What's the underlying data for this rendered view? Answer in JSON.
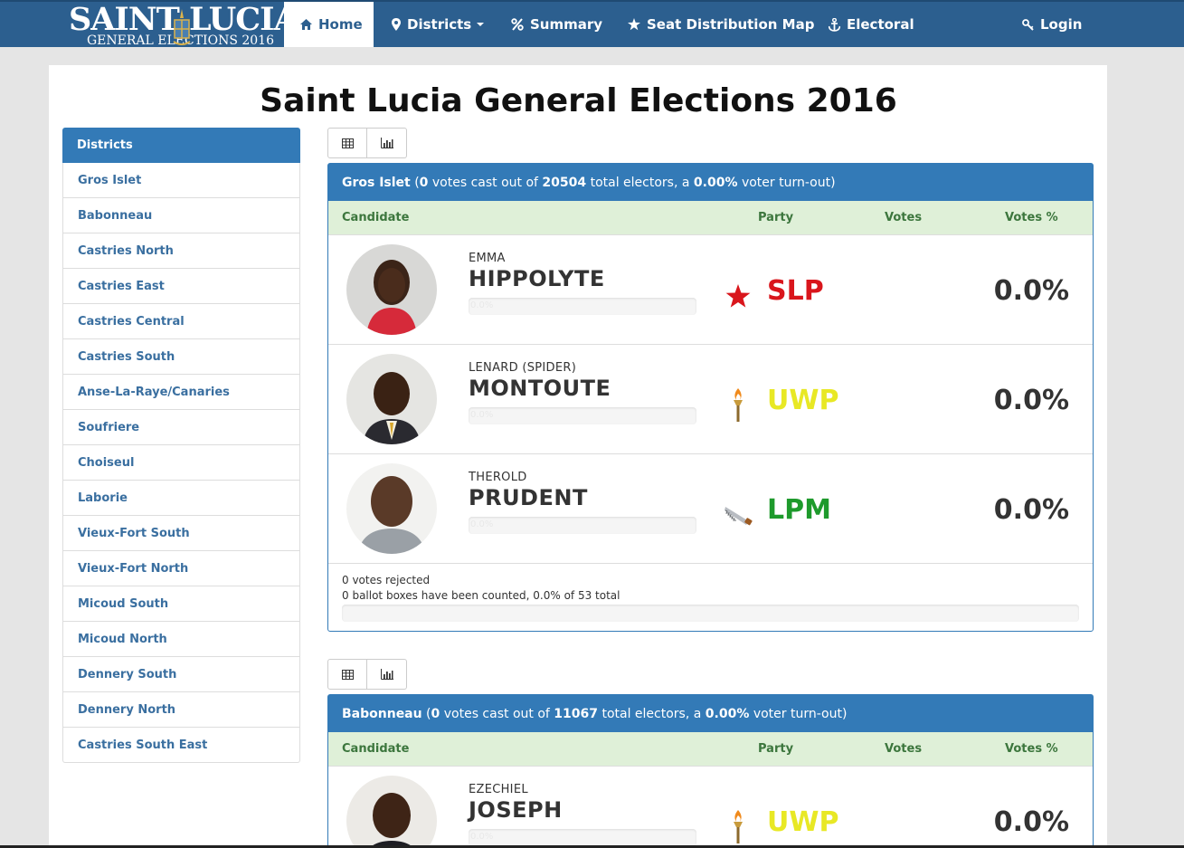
{
  "nav": {
    "brand_line1": "SAINT LUCIA",
    "brand_line2": "GENERAL ELECTIONS 2016",
    "items": [
      {
        "label": "Home",
        "icon": "home-icon",
        "active": true
      },
      {
        "label": "Districts",
        "icon": "map-marker-icon",
        "dropdown": true
      },
      {
        "label": "Summary",
        "icon": "percent-icon"
      },
      {
        "label": "Seat Distribution Map",
        "icon": "star-icon"
      },
      {
        "label": "Electoral",
        "icon": "anchor-icon"
      }
    ],
    "login": {
      "label": "Login",
      "icon": "key-icon"
    }
  },
  "page": {
    "title": "Saint Lucia General Elections 2016"
  },
  "sidebar": {
    "header": "Districts",
    "items": [
      "Gros Islet",
      "Babonneau",
      "Castries North",
      "Castries East",
      "Castries Central",
      "Castries South",
      "Anse-La-Raye/Canaries",
      "Soufriere",
      "Choiseul",
      "Laborie",
      "Vieux-Fort South",
      "Vieux-Fort North",
      "Micoud South",
      "Micoud North",
      "Dennery South",
      "Dennery North",
      "Castries South East"
    ]
  },
  "columns": {
    "candidate": "Candidate",
    "party": "Party",
    "votes": "Votes",
    "votes_pct": "Votes %"
  },
  "colors": {
    "navbar": "#2c5f8f",
    "primary": "#337ab7",
    "slp": "#d9161c",
    "uwp": "#e8e825",
    "lpm": "#1e9a2c"
  },
  "districts": [
    {
      "name": "Gros Islet",
      "votes_cast": "0",
      "text_votes_cast": "votes cast out of",
      "total_electors": "20504",
      "text_total_electors": "total electors, a",
      "turnout": "0.00%",
      "text_turnout": "voter turn-out)",
      "candidates": [
        {
          "first": "EMMA",
          "last": "HIPPOLYTE",
          "bar_label": "0.0%",
          "party": "SLP",
          "emblem": "star-icon",
          "votes": "",
          "pct": "0.0%",
          "party_color": "#d9161c",
          "photo": "emma-hippolyte"
        },
        {
          "first": "LENARD (SPIDER)",
          "last": "MONTOUTE",
          "bar_label": "0.0%",
          "party": "UWP",
          "emblem": "torch-icon",
          "votes": "",
          "pct": "0.0%",
          "party_color": "#e8e825",
          "photo": "lenard-montoute"
        },
        {
          "first": "THEROLD",
          "last": "PRUDENT",
          "bar_label": "0.0%",
          "party": "LPM",
          "emblem": "saw-icon",
          "votes": "",
          "pct": "0.0%",
          "party_color": "#1e9a2c",
          "photo": "therold-prudent"
        }
      ],
      "footer": {
        "rejected": "0 votes rejected",
        "boxes": "0 ballot boxes have been counted, 0.0% of 53 total"
      }
    },
    {
      "name": "Babonneau",
      "votes_cast": "0",
      "text_votes_cast": "votes cast out of",
      "total_electors": "11067",
      "text_total_electors": "total electors, a",
      "turnout": "0.00%",
      "text_turnout": "voter turn-out)",
      "candidates": [
        {
          "first": "EZECHIEL",
          "last": "JOSEPH",
          "bar_label": "0.0%",
          "party": "UWP",
          "emblem": "torch-icon",
          "votes": "",
          "pct": "0.0%",
          "party_color": "#e8e825",
          "photo": "ezechiel-joseph"
        }
      ]
    }
  ]
}
